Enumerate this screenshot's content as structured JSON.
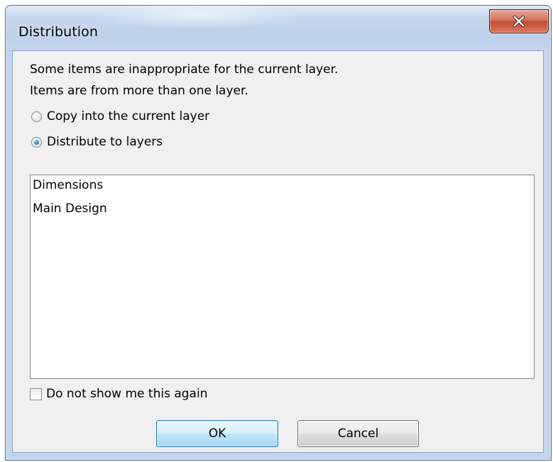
{
  "window": {
    "title": "Distribution",
    "close_icon": "close-x-icon"
  },
  "message": {
    "line1": "Some items are inappropriate for the current layer.",
    "line2": "Items are from more than one layer."
  },
  "options": {
    "copy_label": "Copy into the current layer",
    "distribute_label": "Distribute to layers",
    "selected": "distribute"
  },
  "layers": [
    "Dimensions",
    "Main Design"
  ],
  "checkbox": {
    "label": "Do not show me this again",
    "checked": false
  },
  "buttons": {
    "ok_label": "OK",
    "cancel_label": "Cancel"
  }
}
